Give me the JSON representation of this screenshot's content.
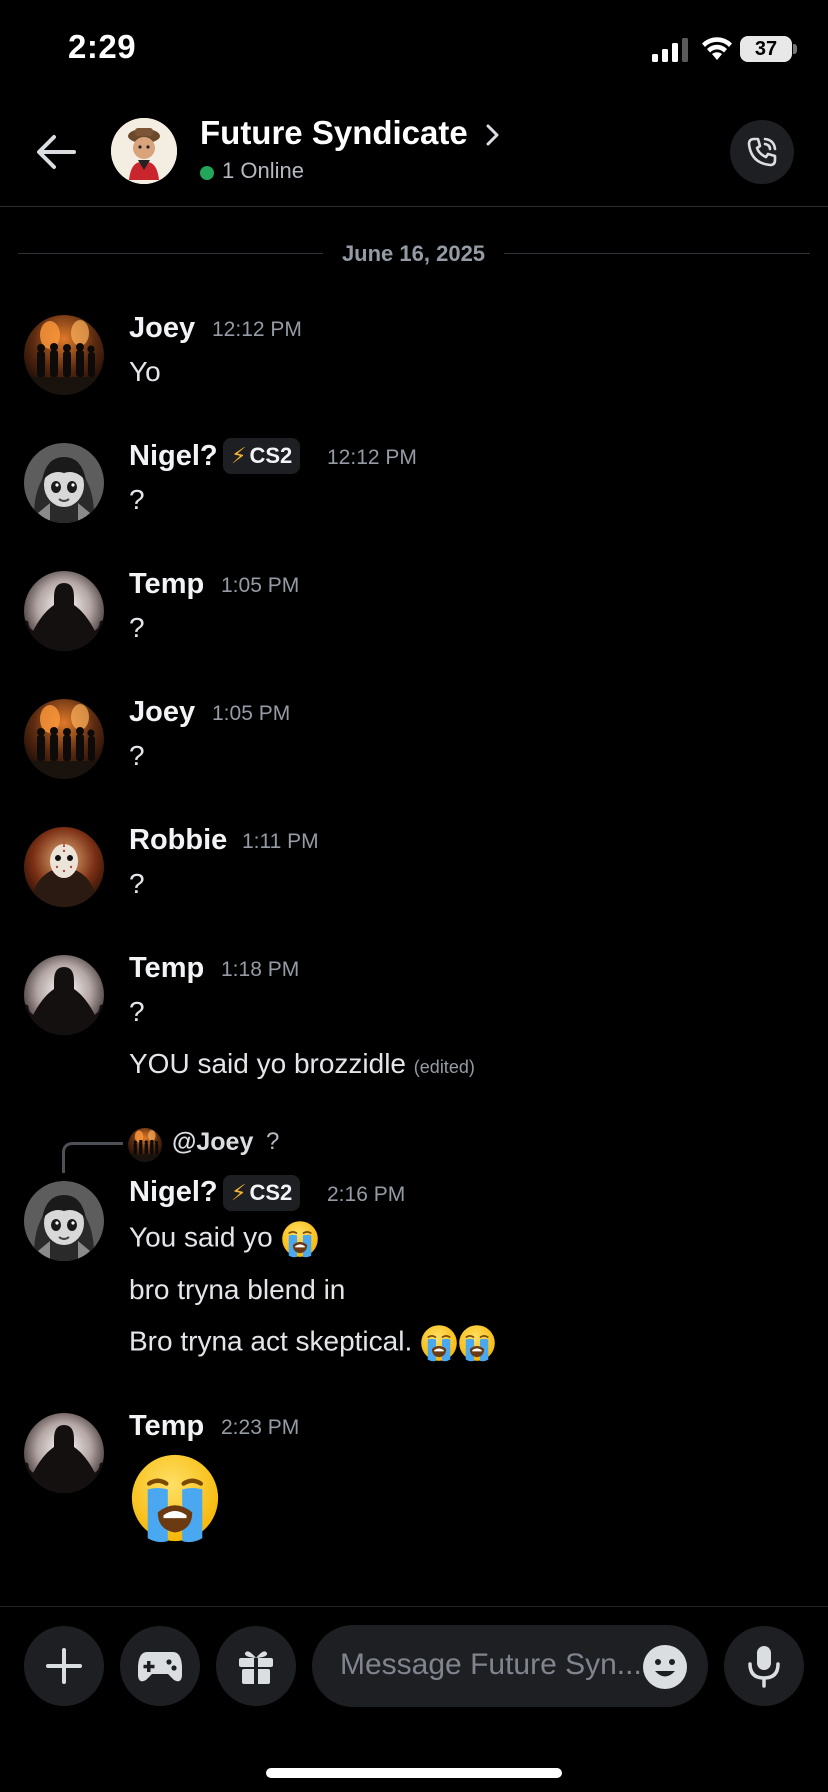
{
  "status_bar": {
    "time": "2:29",
    "battery": "37"
  },
  "header": {
    "title": "Future Syndicate",
    "online": "1 Online"
  },
  "date_divider": "June 16, 2025",
  "messages": [
    {
      "author": "Joey",
      "time": "12:12 PM",
      "lines": [
        "Yo"
      ]
    },
    {
      "author": "Nigel?",
      "tag": "CS2",
      "time": "12:12 PM",
      "lines": [
        "?"
      ]
    },
    {
      "author": "Temp",
      "time": "1:05 PM",
      "lines": [
        "?"
      ]
    },
    {
      "author": "Joey",
      "time": "1:05 PM",
      "lines": [
        "?"
      ]
    },
    {
      "author": "Robbie",
      "time": "1:11 PM",
      "lines": [
        "?"
      ]
    },
    {
      "author": "Temp",
      "time": "1:18 PM",
      "lines": [
        "?",
        "YOU said yo brozzidle"
      ],
      "edited": "(edited)"
    },
    {
      "author": "Nigel?",
      "tag": "CS2",
      "time": "2:16 PM",
      "reply": {
        "mention": "@Joey",
        "text": "?"
      },
      "lines": [
        "You said yo",
        "bro tryna blend in",
        "Bro tryna act skeptical."
      ]
    },
    {
      "author": "Temp",
      "time": "2:23 PM",
      "lines": []
    }
  ],
  "composer": {
    "placeholder": "Message Future Syn..."
  },
  "icons": {
    "back": "arrow-left-icon",
    "call": "phone-call-icon",
    "add": "plus-icon",
    "activities": "gamepad-icon",
    "gift": "gift-icon",
    "emoji": "smiley-icon",
    "voice": "microphone-icon",
    "crying": "loudly-crying-face-emoji"
  },
  "colors": {
    "online": "#23a55a",
    "background": "#000000",
    "bolt": "#f0b232"
  }
}
